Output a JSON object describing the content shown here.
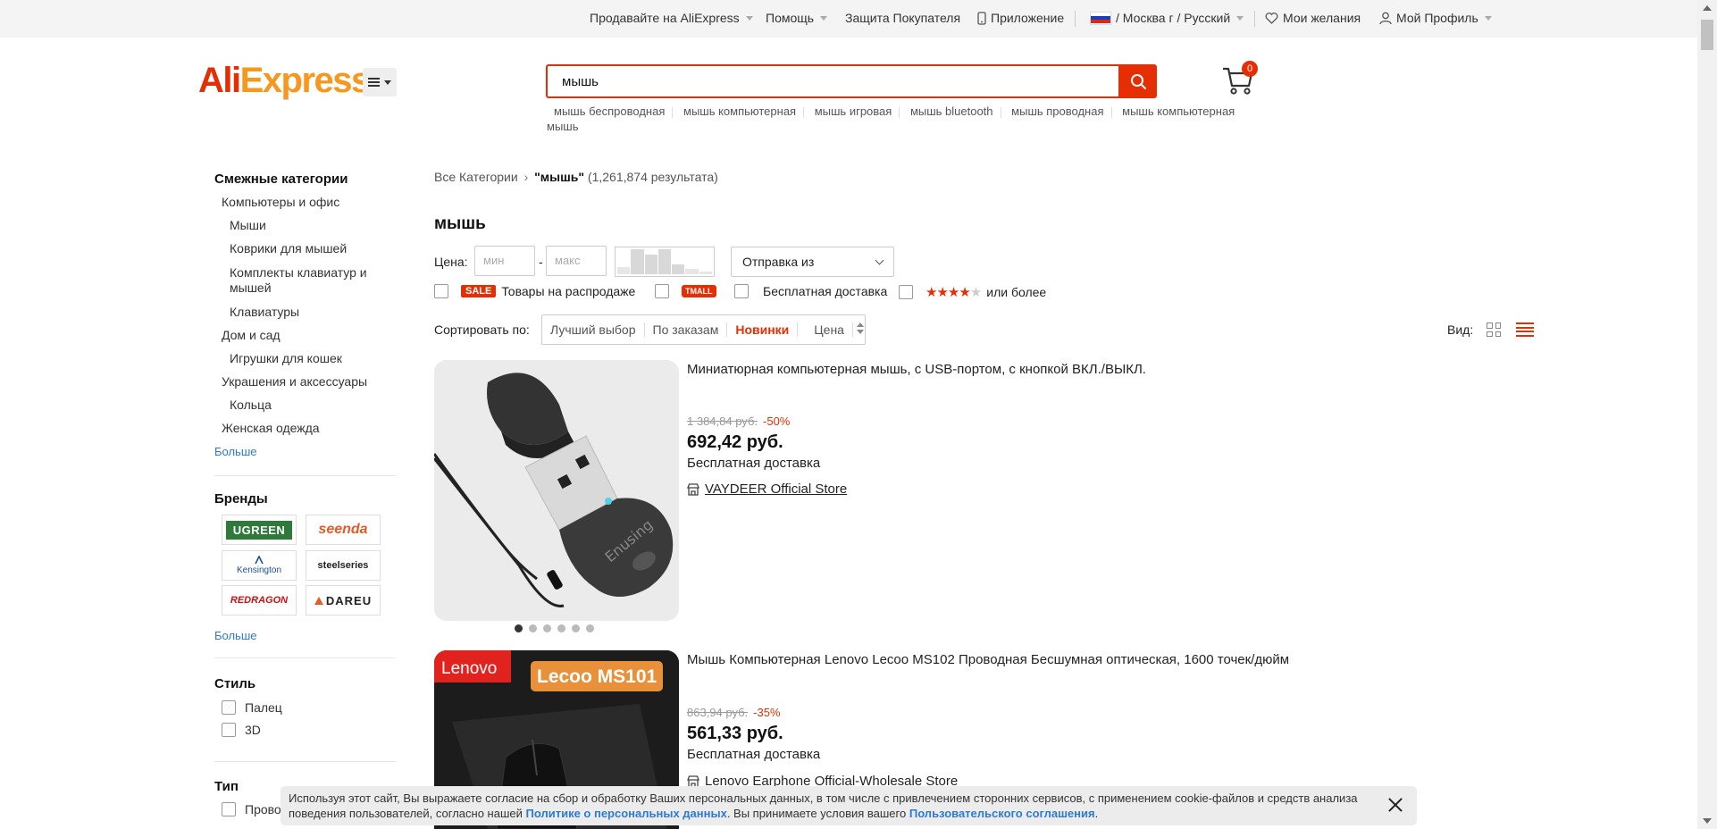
{
  "topnav": {
    "sell": "Продавайте на AliExpress",
    "help": "Помощь",
    "protection": "Защита Покупателя",
    "app": "Приложение",
    "region": "/ Москва г / Русский",
    "wishlist": "Мои желания",
    "profile": "Мой Профиль"
  },
  "header": {
    "logo_ali": "AliExpress",
    "search_value": "мышь",
    "cart_count": "0",
    "suggestions": [
      "мышь беспроводная",
      "мышь компьютерная",
      "мышь игровая",
      "мышь bluetooth",
      "мышь проводная",
      "мышь компьютерная мышь"
    ]
  },
  "sidebar": {
    "related_title": "Смежные категории",
    "categories": [
      {
        "label": "Компьютеры и офис",
        "level": 1
      },
      {
        "label": "Мыши",
        "level": 2
      },
      {
        "label": "Коврики для мышей",
        "level": 2
      },
      {
        "label": "Комплекты клавиатур и",
        "level": 2
      },
      {
        "label": "мышей",
        "level": 2
      },
      {
        "label": "Клавиатуры",
        "level": 2
      },
      {
        "label": "Дом и сад",
        "level": 1
      },
      {
        "label": "Игрушки для кошек",
        "level": 2
      },
      {
        "label": "Украшения и аксессуары",
        "level": 1
      },
      {
        "label": "Кольца",
        "level": 2
      },
      {
        "label": "Женская одежда",
        "level": 1
      }
    ],
    "more": "Больше",
    "brands_title": "Бренды",
    "brands": [
      "UGREEN",
      "seenda",
      "Kensington",
      "steelseries",
      "REDRAGON",
      "DAREU"
    ],
    "brands_more": "Больше",
    "style_title": "Стиль",
    "styles": [
      "Палец",
      "3D"
    ],
    "type_title": "Тип",
    "types": [
      "Прово"
    ]
  },
  "main": {
    "breadcrumb_all": "Все Категории",
    "breadcrumb_query": "\"мышь\"",
    "breadcrumb_count": "(1,261,874 результата)",
    "title": "мышь",
    "price_label": "Цена:",
    "price_min_placeholder": "мин",
    "price_max_placeholder": "макс",
    "price_dash": "-",
    "ship_from": "Отправка из",
    "filter_sale_tag": "SALE",
    "filter_sale": "Товары на распродаже",
    "filter_tmall_tag": "TMALL",
    "filter_free": "Бесплатная доставка",
    "filter_rating_stars": "★★★★",
    "filter_rating_empty": "★",
    "filter_rating": "или более",
    "sort_label": "Сортировать по:",
    "sort_options": [
      "Лучший выбор",
      "По заказам",
      "Новинки",
      "Цена"
    ],
    "sort_active": "Новинки",
    "view_label": "Вид:"
  },
  "products": [
    {
      "title": "Миниатюрная компьютерная мышь, с USB-портом, с кнопкой ВКЛ./ВЫКЛ.",
      "old_price": "1 384,84 руб.",
      "discount": "-50%",
      "price": "692,42 руб.",
      "shipping": "Бесплатная доставка",
      "store": "VAYDEER Official Store",
      "image_text": "Enusing"
    },
    {
      "title": "Мышь Компьютерная Lenovo Lecoo MS102 Проводная Бесшумная оптическая, 1600 точек/дюйм",
      "old_price": "863,94 руб.",
      "discount": "-35%",
      "price": "561,33 руб.",
      "shipping": "Бесплатная доставка",
      "store": "Lenovo Earphone Official-Wholesale Store",
      "image_badge_1": "Lenovo",
      "image_badge_2": "Lecoo MS101"
    }
  ],
  "cookie": {
    "text_1": "Используя этот сайт, Вы выражаете согласие на сбор и обработку Ваших персональных данных, в том числе с привлечением сторонних сервисов, с применением cookie-файлов и средств анализа поведения пользователей, согласно нашей ",
    "link_1": "Политике о персональных данных",
    "text_2": ". Вы принимаете условия вашего ",
    "link_2": "Пользовательского соглашения",
    "text_3": "."
  },
  "colors": {
    "accent": "#e62e04",
    "link": "#2e7bcf",
    "logo_secondary": "#f7971e"
  }
}
